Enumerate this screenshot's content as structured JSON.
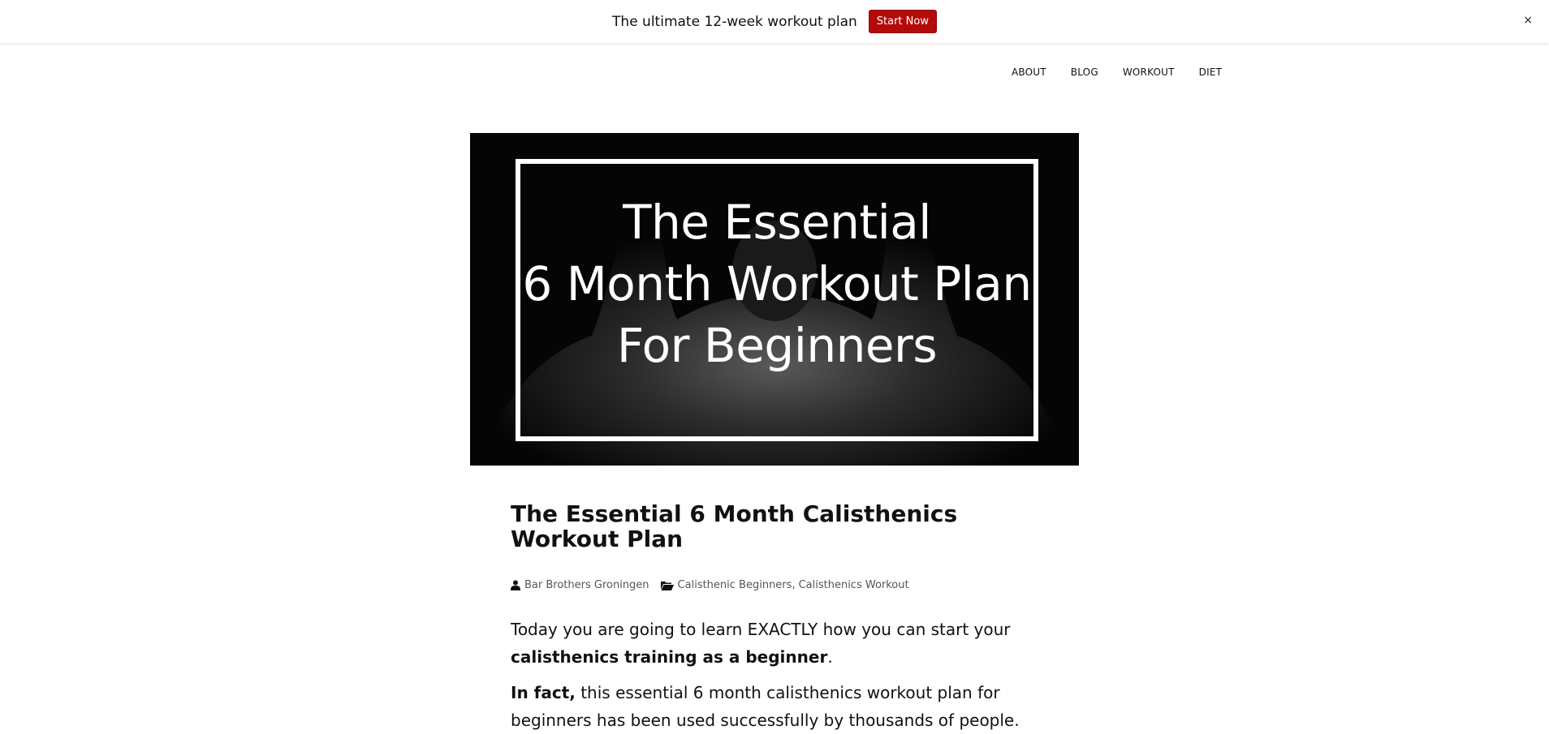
{
  "promo": {
    "text": "The ultimate 12-week workout plan",
    "button": "Start Now",
    "close": "×",
    "button_color": "#b50a0a"
  },
  "nav": {
    "items": [
      "ABOUT",
      "BLOG",
      "WORKOUT",
      "DIET"
    ]
  },
  "hero": {
    "lines": [
      "The Essential",
      "6 Month Workout Plan",
      "For Beginners"
    ]
  },
  "article": {
    "title": "The Essential 6 Month Calisthenics Workout Plan",
    "author": "Bar Brothers Groningen",
    "categories": [
      "Calisthenic Beginners",
      "Calisthenics Workout"
    ],
    "category_separator": ",",
    "p1_a": "Today you are going to learn EXACTLY how you can start your ",
    "p1_bold": "calisthenics training as a beginner",
    "p1_end": ".",
    "p2_bold": "In fact,",
    "p2_rest": " this essential 6 month calisthenics workout plan for beginners has been used successfully by thousands of people."
  }
}
